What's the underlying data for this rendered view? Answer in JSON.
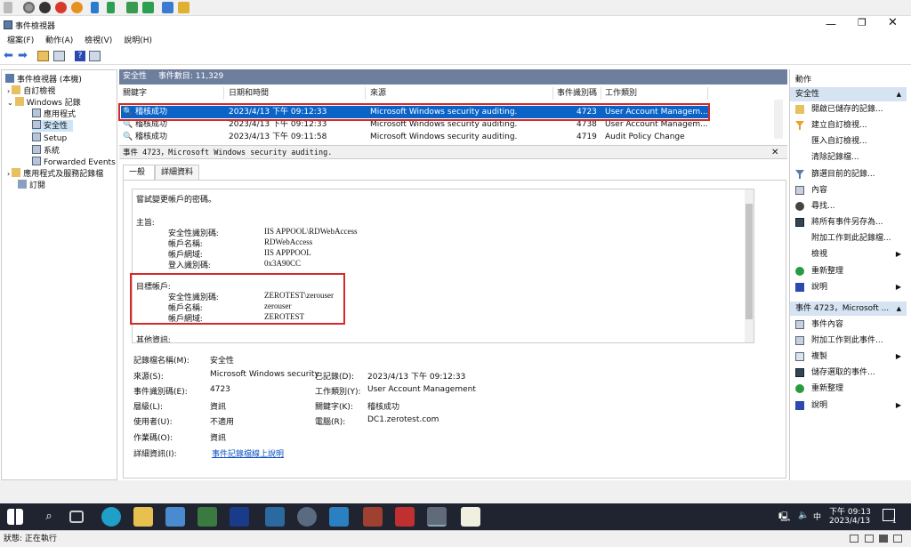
{
  "window": {
    "title": "事件檢視器"
  },
  "menu": [
    "檔案(F)",
    "動作(A)",
    "檢視(V)",
    "說明(H)"
  ],
  "tree": {
    "root": "事件檢視器 (本機)",
    "custom_views": "自訂檢視",
    "windows_logs": "Windows 記錄",
    "application": "應用程式",
    "security": "安全性",
    "setup": "Setup",
    "system": "系統",
    "forwarded": "Forwarded Events",
    "app_services": "應用程式及服務記錄檔",
    "subscriptions": "訂閱"
  },
  "list": {
    "header_name": "安全性",
    "header_count": "事件數目: 11,329",
    "columns": [
      "關鍵字",
      "日期和時間",
      "來源",
      "事件識別碼",
      "工作類別"
    ],
    "rows": [
      {
        "kw": "稽核成功",
        "dt": "2023/4/13 下午 09:12:33",
        "src": "Microsoft Windows security auditing.",
        "id": "4723",
        "cat": "User Account Managem..."
      },
      {
        "kw": "稽核成功",
        "dt": "2023/4/13 下午 09:12:33",
        "src": "Microsoft Windows security auditing.",
        "id": "4738",
        "cat": "User Account Managem..."
      },
      {
        "kw": "稽核成功",
        "dt": "2023/4/13 下午 09:11:58",
        "src": "Microsoft Windows security auditing.",
        "id": "4719",
        "cat": "Audit Policy Change"
      }
    ]
  },
  "detail": {
    "header": "事件 4723，Microsoft Windows security auditing.",
    "tabs": [
      "一般",
      "詳細資料"
    ],
    "desc": {
      "line1": "嘗試變更帳戶的密碼。",
      "subject": "主旨:",
      "s_sid_k": "安全性識別碼:",
      "s_sid_v": "IIS APPOOL\\RDWebAccess",
      "s_name_k": "帳戶名稱:",
      "s_name_v": "RDWebAccess",
      "s_dom_k": "帳戶網域:",
      "s_dom_v": "IIS APPPOOL",
      "s_logon_k": "登入識別碼:",
      "s_logon_v": "0x3A90CC",
      "target": "目標帳戶:",
      "t_sid_k": "安全性識別碼:",
      "t_sid_v": "ZEROTEST\\zerouser",
      "t_name_k": "帳戶名稱:",
      "t_name_v": "zerouser",
      "t_dom_k": "帳戶網域:",
      "t_dom_v": "ZEROTEST",
      "other": "其他資訊:"
    },
    "props": {
      "logname_k": "記錄檔名稱(M):",
      "logname_v": "安全性",
      "source_k": "來源(S):",
      "source_v": "Microsoft Windows security",
      "logged_k": "已記錄(D):",
      "logged_v": "2023/4/13 下午 09:12:33",
      "eventid_k": "事件識別碼(E):",
      "eventid_v": "4723",
      "taskcat_k": "工作類別(Y):",
      "taskcat_v": "User Account Management",
      "level_k": "層級(L):",
      "level_v": "資訊",
      "keywords_k": "關鍵字(K):",
      "keywords_v": "稽核成功",
      "user_k": "使用者(U):",
      "user_v": "不適用",
      "computer_k": "電腦(R):",
      "computer_v": "DC1.zerotest.com",
      "opcode_k": "作業碼(O):",
      "opcode_v": "資訊",
      "more_k": "詳細資訊(I):",
      "more_link": "事件記錄檔線上說明"
    }
  },
  "actions": {
    "title": "動作",
    "section1": "安全性",
    "items1": [
      "開啟已儲存的記錄...",
      "建立自訂檢視...",
      "匯入自訂檢視...",
      "清除記錄檔...",
      "篩選目前的記錄...",
      "內容",
      "尋找...",
      "將所有事件另存為...",
      "附加工作到此記錄檔...",
      "檢視",
      "重新整理",
      "說明"
    ],
    "section2": "事件 4723，Microsoft ...",
    "items2": [
      "事件內容",
      "附加工作到此事件...",
      "複製",
      "儲存選取的事件...",
      "重新整理",
      "說明"
    ]
  },
  "taskbar": {
    "time": "下午 09:13",
    "date": "2023/4/13",
    "ime": "中",
    "notif": "1"
  },
  "status": {
    "text": "狀態: 正在執行"
  },
  "colors": {
    "selected": "#0a64c8",
    "header": "#6e7f9e",
    "action_header": "#d6e3f3",
    "highlight": "#d42a2a",
    "taskbar": "#1f2430"
  }
}
